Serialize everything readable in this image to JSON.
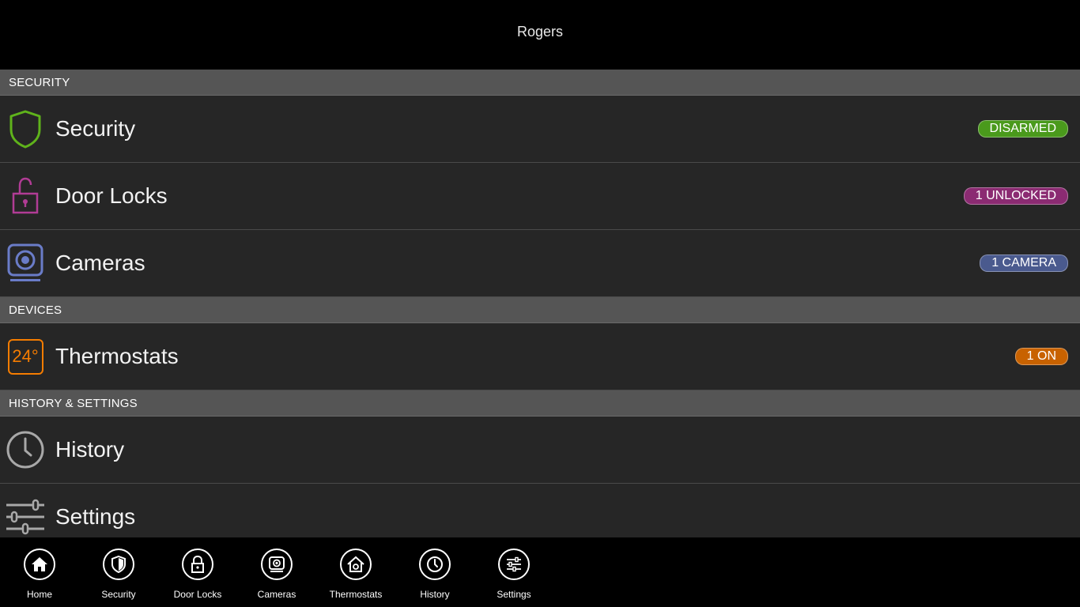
{
  "header": {
    "title": "Rogers"
  },
  "sections": {
    "security": "SECURITY",
    "devices": "DEVICES",
    "history_settings": "HISTORY & SETTINGS"
  },
  "rows": {
    "security": {
      "label": "Security",
      "badge": "DISARMED",
      "badge_color": "#4a9a1c",
      "icon": "shield-icon"
    },
    "door_locks": {
      "label": "Door Locks",
      "badge": "1 UNLOCKED",
      "badge_color": "#8b2b72",
      "icon": "padlock-open-icon"
    },
    "cameras": {
      "label": "Cameras",
      "badge": "1 CAMERA",
      "badge_color": "#4a5a8e",
      "icon": "camera-icon"
    },
    "thermostats": {
      "label": "Thermostats",
      "badge": "1 ON",
      "badge_color": "#c86200",
      "icon": "thermostat-icon",
      "temp": "24°"
    },
    "history": {
      "label": "History",
      "icon": "clock-icon"
    },
    "settings": {
      "label": "Settings",
      "icon": "sliders-icon"
    }
  },
  "appbar": {
    "home": "Home",
    "security": "Security",
    "door_locks": "Door Locks",
    "cameras": "Cameras",
    "thermostats": "Thermostats",
    "history": "History",
    "settings": "Settings"
  }
}
